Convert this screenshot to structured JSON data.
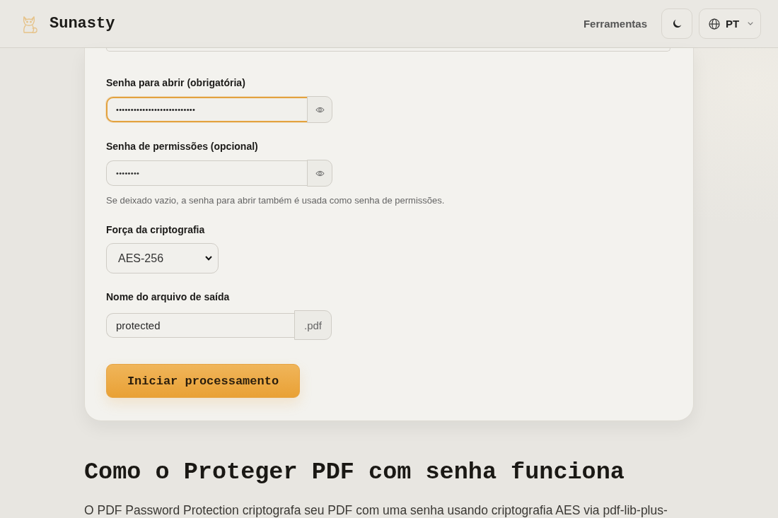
{
  "header": {
    "brand": "Sunasty",
    "nav_link": "Ferramentas",
    "language": "PT"
  },
  "form": {
    "fields": [
      {
        "kind": "password",
        "label": "Senha para abrir (obrigatória)",
        "value": "•••••••••••••••••••••••••••",
        "focused": true
      },
      {
        "kind": "password",
        "label": "Senha de permissões (opcional)",
        "value": "••••••••",
        "focused": false,
        "hint": "Se deixado vazio, a senha para abrir também é usada como senha de permissões."
      },
      {
        "kind": "select",
        "label": "Força da criptografia",
        "value": "AES-256"
      },
      {
        "kind": "suffix",
        "label": "Nome do arquivo de saída",
        "value": "protected",
        "suffix": ".pdf"
      }
    ],
    "submit": "Iniciar processamento"
  },
  "section": {
    "heading": "Como o Proteger PDF com senha funciona",
    "paragraph": "O PDF Password Protection criptografa seu PDF com uma senha usando criptografia AES via pdf-lib-plus-"
  }
}
